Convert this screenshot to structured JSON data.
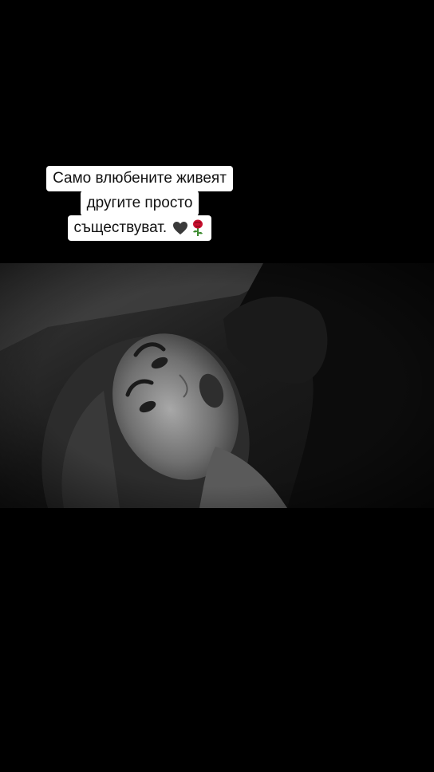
{
  "caption": {
    "line1": "Само влюбените живеят",
    "line2": "другите просто",
    "line3": "съществуват.",
    "emojis": [
      "black-heart-icon",
      "rose-icon"
    ]
  },
  "photo": {
    "style": "black-and-white",
    "subject": "portrait"
  }
}
